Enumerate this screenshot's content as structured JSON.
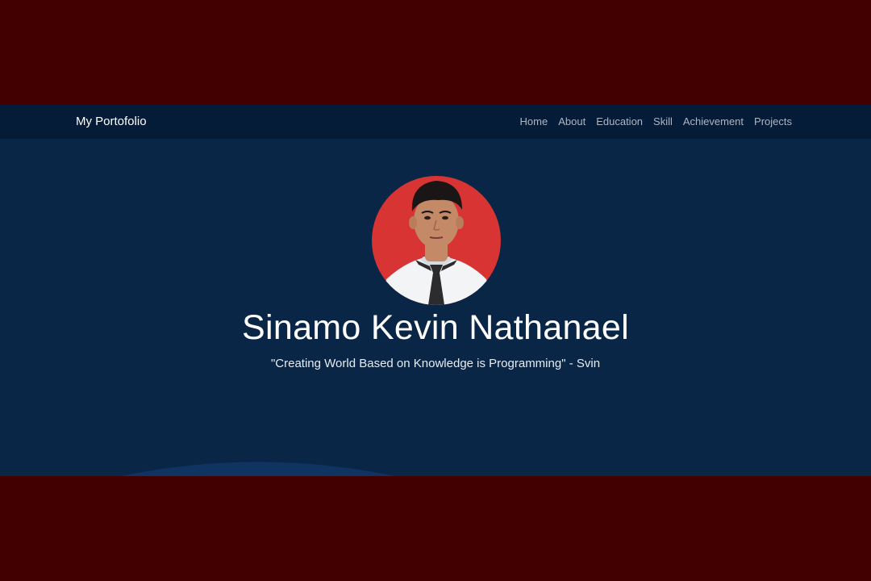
{
  "navbar": {
    "brand": "My Portofolio",
    "links": [
      "Home",
      "About",
      "Education",
      "Skill",
      "Achievement",
      "Projects"
    ]
  },
  "hero": {
    "name": "Sinamo Kevin Nathanael",
    "quote": "\"Creating World Based on Knowledge is Programming\" - Svin"
  },
  "colors": {
    "letterbox": "#420000",
    "page_background": "#0a2647",
    "navbar_background": "#041c38",
    "avatar_background": "#d93434",
    "nav_link": "#aab6c4"
  }
}
